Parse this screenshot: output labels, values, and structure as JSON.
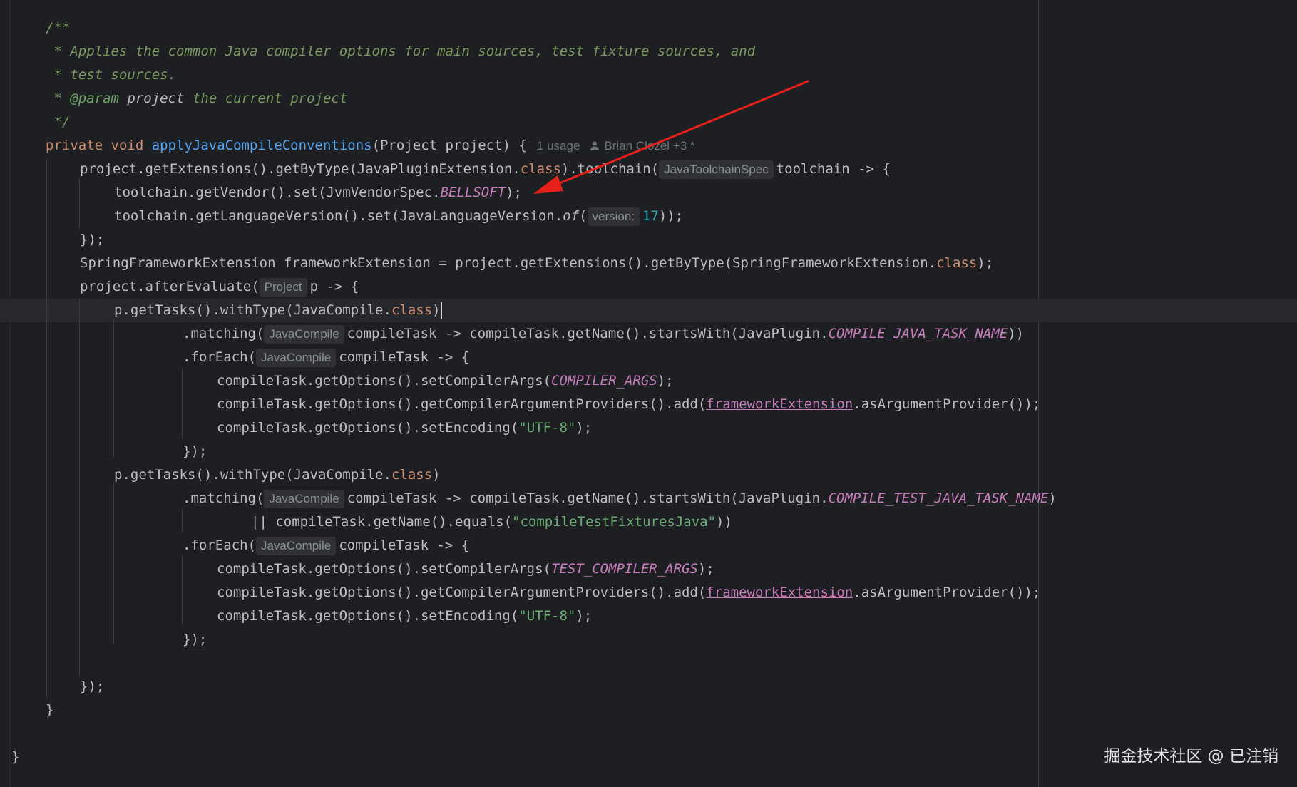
{
  "doc": {
    "c1": "/**",
    "c2": " * Applies the common Java compiler options for main sources, test fixture sources, and",
    "c3": " * test sources.",
    "c4a": " * ",
    "c4tag": "@param",
    "c4sp": " ",
    "c4name": "project",
    "c4rest": " the current project",
    "c5": " */"
  },
  "sig": {
    "mod": "private void ",
    "name": "applyJavaCompileConventions",
    "params": "(Project project) {",
    "usage": "1 usage",
    "author": "Brian Clozel +3 *"
  },
  "l7": {
    "a": "project.getExtensions().getByType(JavaPluginExtension.",
    "kw": "class",
    "b": ").toolchain(",
    "hint": "JavaToolchainSpec",
    "c": "toolchain -> {"
  },
  "l8": {
    "a": "toolchain.getVendor().set(JvmVendorSpec.",
    "const": "BELLSOFT",
    "b": ");"
  },
  "l9": {
    "a": "toolchain.getLanguageVersion().set(JavaLanguageVersion.",
    "of": "of",
    "b": "(",
    "hint": "version:",
    "num": "17",
    "c": "));"
  },
  "l10": "});",
  "l11": {
    "a": "SpringFrameworkExtension frameworkExtension = project.getExtensions().getByType(SpringFrameworkExtension.",
    "kw": "class",
    "b": ");"
  },
  "l12": {
    "a": "project.afterEvaluate(",
    "hint": "Project",
    "b": "p -> {"
  },
  "l13": {
    "a": "p.getTasks().withType(JavaCompile.",
    "kw": "class",
    "b": ")"
  },
  "l14": {
    "a": ".matching(",
    "hint": "JavaCompile",
    "b": "compileTask -> compileTask.getName().startsWith(JavaPlugin.",
    "const": "COMPILE_JAVA_TASK_NAME",
    "c": "))"
  },
  "l15": {
    "a": ".forEach(",
    "hint": "JavaCompile",
    "b": "compileTask -> {"
  },
  "l16": {
    "a": "compileTask.getOptions().setCompilerArgs(",
    "const": "COMPILER_ARGS",
    "b": ");"
  },
  "l17": {
    "a": "compileTask.getOptions().getCompilerArgumentProviders().add(",
    "fld": "frameworkExtension",
    "b": ".asArgumentProvider());"
  },
  "l18": {
    "a": "compileTask.getOptions().setEncoding(",
    "str": "\"UTF-8\"",
    "b": ");"
  },
  "l19": "});",
  "l20": {
    "a": "p.getTasks().withType(JavaCompile.",
    "kw": "class",
    "b": ")"
  },
  "l21": {
    "a": ".matching(",
    "hint": "JavaCompile",
    "b": "compileTask -> compileTask.getName().startsWith(JavaPlugin.",
    "const": "COMPILE_TEST_JAVA_TASK_NAME",
    "c": ")"
  },
  "l22": {
    "a": "|| compileTask.getName().equals(",
    "str": "\"compileTestFixturesJava\"",
    "b": "))"
  },
  "l23": {
    "a": ".forEach(",
    "hint": "JavaCompile",
    "b": "compileTask -> {"
  },
  "l24": {
    "a": "compileTask.getOptions().setCompilerArgs(",
    "const": "TEST_COMPILER_ARGS",
    "b": ");"
  },
  "l25": {
    "a": "compileTask.getOptions().getCompilerArgumentProviders().add(",
    "fld": "frameworkExtension",
    "b": ".asArgumentProvider());"
  },
  "l26": {
    "a": "compileTask.getOptions().setEncoding(",
    "str": "\"UTF-8\"",
    "b": ");"
  },
  "l27": "});",
  "l29": "});",
  "l30": "}",
  "l32": "}",
  "colors": {
    "background": "#1e1f22",
    "keyword": "#cf8e6d",
    "method_declaration": "#56a8f5",
    "constant": "#c77dbb",
    "string": "#6aab73",
    "number": "#2aacb8",
    "comment": "#7a9a62",
    "annotation_arrow": "#e8201a"
  },
  "watermark": "掘金技术社区 @ 已注销"
}
